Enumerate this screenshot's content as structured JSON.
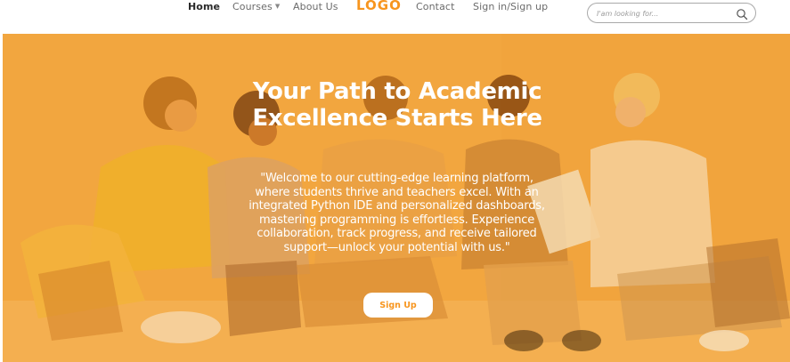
{
  "nav": {
    "home": "Home",
    "courses": "Courses",
    "about": "About Us",
    "logo": "LOGO",
    "contact": "Contact",
    "auth": "Sign in/Sign up",
    "search_placeholder": "I'am looking for...",
    "search_icon": "search-icon"
  },
  "hero": {
    "title": "Your Path to Academic Excellence Starts Here",
    "description": "\"Welcome to our cutting-edge learning platform, where students thrive and teachers excel. With an integrated Python IDE and personalized dashboards, mastering programming is effortless. Experience collaboration, track progress, and receive tailored support—unlock your potential with us.\"",
    "cta": "Sign Up"
  },
  "colors": {
    "brand_orange": "#f7951e",
    "hero_tint": "#f3a845",
    "nav_active": "#2b2b2b",
    "nav_text": "#6b6b6b"
  }
}
